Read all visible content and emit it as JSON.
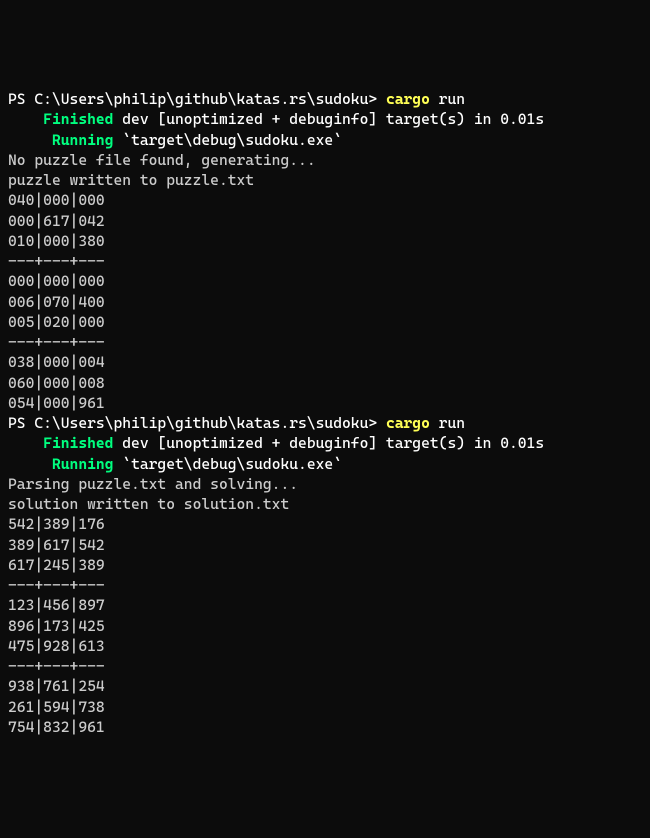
{
  "runs": [
    {
      "prompt_ps": "PS ",
      "prompt_path": "C:\\Users\\philip\\github\\katas.rs\\sudoku> ",
      "cmd_bin": "cargo",
      "cmd_arg": " run",
      "finished_indent": "    ",
      "finished_kw": "Finished",
      "finished_rest": " dev [unoptimized + debuginfo] target(s) in 0.01s",
      "running_indent": "     ",
      "running_kw": "Running",
      "running_rest": " `target\\debug\\sudoku.exe`",
      "output": [
        "No puzzle file found, generating...",
        "puzzle written to puzzle.txt",
        "040|000|000",
        "000|617|042",
        "010|000|380",
        "---+---+---",
        "000|000|000",
        "006|070|400",
        "005|020|000",
        "---+---+---",
        "038|000|004",
        "060|000|008",
        "054|000|961",
        ""
      ]
    },
    {
      "prompt_ps": "PS ",
      "prompt_path": "C:\\Users\\philip\\github\\katas.rs\\sudoku> ",
      "cmd_bin": "cargo",
      "cmd_arg": " run",
      "finished_indent": "    ",
      "finished_kw": "Finished",
      "finished_rest": " dev [unoptimized + debuginfo] target(s) in 0.01s",
      "running_indent": "     ",
      "running_kw": "Running",
      "running_rest": " `target\\debug\\sudoku.exe`",
      "output": [
        "Parsing puzzle.txt and solving...",
        "solution written to solution.txt",
        "542|389|176",
        "389|617|542",
        "617|245|389",
        "---+---+---",
        "123|456|897",
        "896|173|425",
        "475|928|613",
        "---+---+---",
        "938|761|254",
        "261|594|738",
        "754|832|961"
      ]
    }
  ]
}
